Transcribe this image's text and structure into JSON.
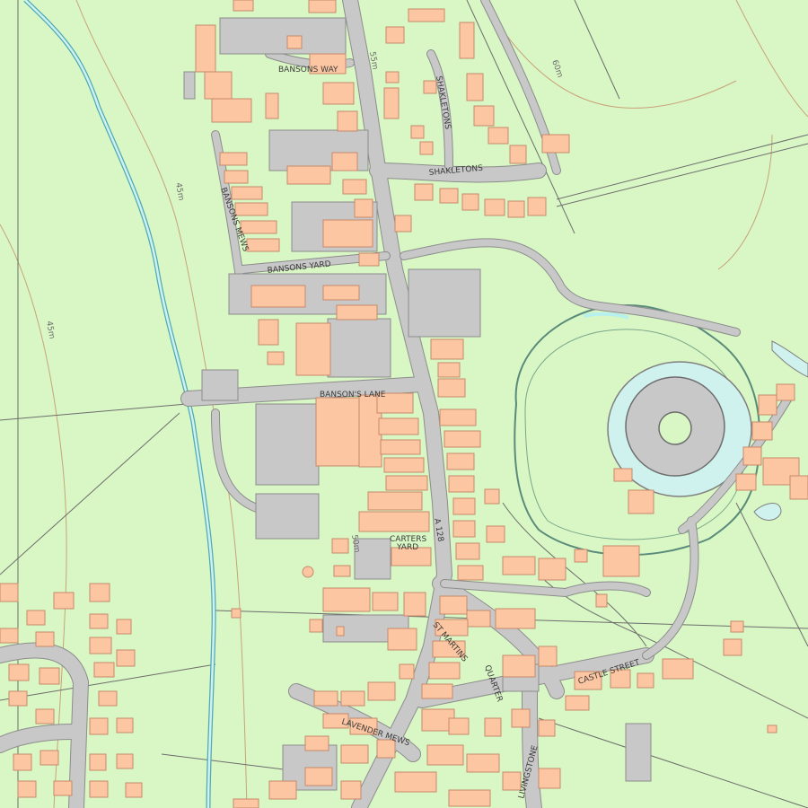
{
  "map": {
    "colors": {
      "land": "#d9f7c4",
      "road": "#c8c8c8",
      "road_edge": "#8c8c8c",
      "building": "#fcc6a2",
      "building_edge": "#c88a6a",
      "water": "#d0f2ee",
      "river_edge": "#4fa9b7",
      "contour": "#c9a27a",
      "boundary": "#6d6d6d",
      "label": "#3a3a3a"
    },
    "labels": {
      "bansons_way": "BANSONS WAY",
      "shakletons_vertical": "SHAKLETONS",
      "shakletons_horizontal": "SHAKLETONS",
      "bansons_mews": "BANSONS MEWS",
      "bansons_yard": "BANSONS YARD",
      "bansons_lane": "BANSON'S LANE",
      "carters_yard_line1": "CARTERS",
      "carters_yard_line2": "YARD",
      "a128": "A 128",
      "st_martins": "ST MARTINS",
      "quarter": "QUARTER",
      "castle_street": "CASTLE STREET",
      "lavender_mews": "LAVENDER MEWS",
      "livingstone": "LIVINGSTONE",
      "contour_60m": "60m",
      "contour_55m": "55m",
      "contour_45m_upper": "45m",
      "contour_45m_lower": "45m",
      "contour_50m": "50m"
    }
  }
}
